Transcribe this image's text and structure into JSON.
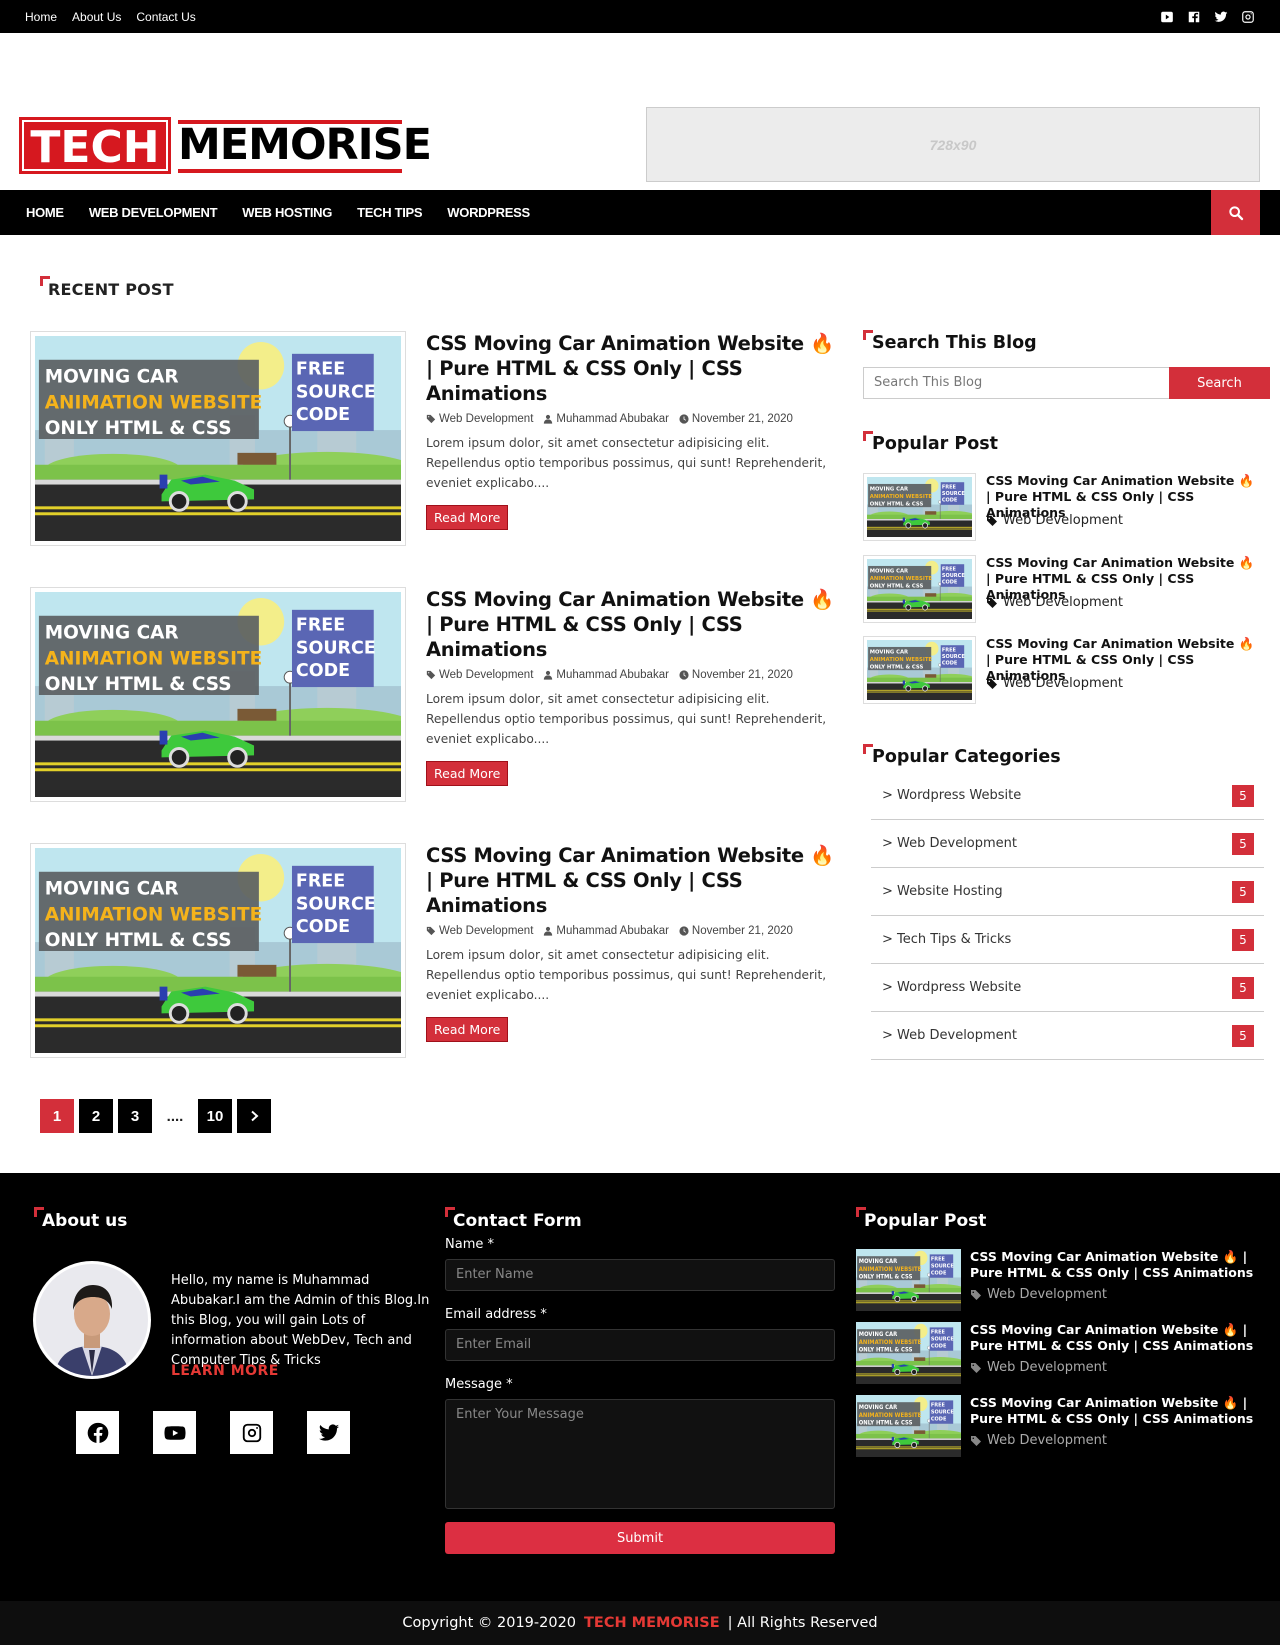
{
  "topbar": {
    "links": [
      "Home",
      "About Us",
      "Contact Us"
    ],
    "social_icons": [
      "youtube-icon",
      "facebook-icon",
      "twitter-icon",
      "instagram-icon"
    ]
  },
  "header": {
    "logo_part1": "TECH",
    "logo_part2": "MEMORISE",
    "ad_text": "728x90"
  },
  "nav": {
    "items": [
      "HOME",
      "WEB DEVELOPMENT",
      "WEB HOSTING",
      "TECH TIPS",
      "WORDPRESS"
    ]
  },
  "recent": {
    "title": "RECENT POST",
    "posts": [
      {
        "title": "CSS Moving Car Animation Website 🔥 | Pure HTML & CSS Only | CSS Animations",
        "category": "Web Development",
        "author": "Muhammad Abubakar",
        "date": "November 21, 2020",
        "excerpt": "Lorem ipsum dolor, sit amet consectetur adipisicing elit. Repellendus optio temporibus possimus, qui sunt! Reprehenderit, eveniet explicabo....",
        "button": "Read More"
      },
      {
        "title": "CSS Moving Car Animation Website 🔥 | Pure HTML & CSS Only | CSS Animations",
        "category": "Web Development",
        "author": "Muhammad Abubakar",
        "date": "November 21, 2020",
        "excerpt": "Lorem ipsum dolor, sit amet consectetur adipisicing elit. Repellendus optio temporibus possimus, qui sunt! Reprehenderit, eveniet explicabo....",
        "button": "Read More"
      },
      {
        "title": "CSS Moving Car Animation Website 🔥 | Pure HTML & CSS Only | CSS Animations",
        "category": "Web Development",
        "author": "Muhammad Abubakar",
        "date": "November 21, 2020",
        "excerpt": "Lorem ipsum dolor, sit amet consectetur adipisicing elit. Repellendus optio temporibus possimus, qui sunt! Reprehenderit, eveniet explicabo....",
        "button": "Read More"
      }
    ],
    "thumb_text": {
      "line1": "MOVING CAR",
      "line2": "ANIMATION WEBSITE",
      "line3": "ONLY HTML & CSS",
      "badge1": "FREE",
      "badge2": "SOURCE",
      "badge3": "CODE"
    }
  },
  "pagination": {
    "pages": [
      "1",
      "2",
      "3",
      "....",
      "10"
    ],
    "active": "1"
  },
  "sidebar": {
    "search_title": "Search This Blog",
    "search_placeholder": "Search This Blog",
    "search_button": "Search",
    "popular_title": "Popular Post",
    "popular": [
      {
        "title": "CSS Moving Car Animation Website 🔥 | Pure HTML & CSS Only | CSS Animations",
        "category": "Web Development"
      },
      {
        "title": "CSS Moving Car Animation Website 🔥 | Pure HTML & CSS Only | CSS Animations",
        "category": "Web Development"
      },
      {
        "title": "CSS Moving Car Animation Website 🔥 | Pure HTML & CSS Only | CSS Animations",
        "category": "Web Development"
      }
    ],
    "categories_title": "Popular Categories",
    "categories": [
      {
        "label": "> Wordpress Website",
        "count": "5"
      },
      {
        "label": "> Web Development",
        "count": "5"
      },
      {
        "label": "> Website Hosting",
        "count": "5"
      },
      {
        "label": "> Tech Tips & Tricks",
        "count": "5"
      },
      {
        "label": "> Wordpress Website",
        "count": "5"
      },
      {
        "label": "> Web Development",
        "count": "5"
      }
    ]
  },
  "footer": {
    "about_title": "About us",
    "about_text": "Hello, my name is Muhammad Abubakar.I am the Admin of this Blog.In this Blog, you will gain Lots of information about WebDev, Tech and Computer Tips & Tricks",
    "learn_more": "LEARN MORE",
    "contact_title": "Contact Form",
    "name_label": "Name *",
    "name_placeholder": "Enter Name",
    "email_label": "Email address *",
    "email_placeholder": "Enter Email",
    "message_label": "Message *",
    "message_placeholder": "Enter Your Message",
    "submit": "Submit",
    "popular_title": "Popular Post",
    "popular": [
      {
        "title": "CSS Moving Car Animation Website 🔥 | Pure HTML & CSS Only | CSS Animations",
        "category": "Web Development"
      },
      {
        "title": "CSS Moving Car Animation Website 🔥 | Pure HTML & CSS Only | CSS Animations",
        "category": "Web Development"
      },
      {
        "title": "CSS Moving Car Animation Website 🔥 | Pure HTML & CSS Only | CSS Animations",
        "category": "Web Development"
      }
    ],
    "social_icons": [
      "facebook-icon",
      "youtube-icon",
      "instagram-icon",
      "twitter-icon"
    ]
  },
  "copyright": {
    "prefix": "Copyright © 2019-2020",
    "brand": "TECH MEMORISE",
    "suffix": "|  All Rights Reserved"
  },
  "colors": {
    "accent": "#d32f3a",
    "dark": "#000000",
    "brand_red": "#d6181f"
  }
}
